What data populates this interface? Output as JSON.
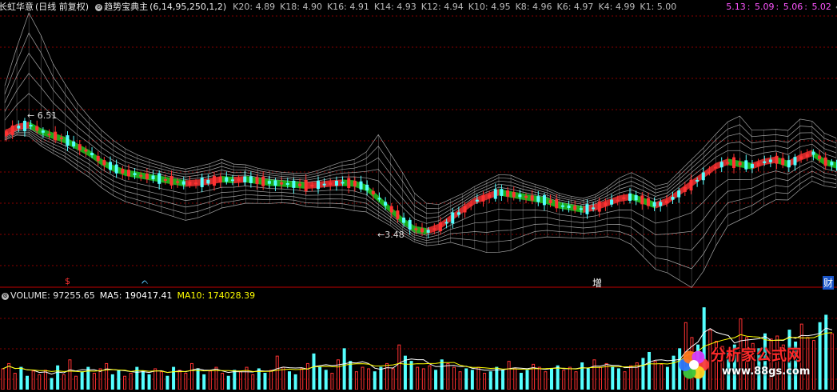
{
  "header": {
    "stock_name": "长虹华意",
    "period": "(日线 前复权)",
    "indicator_name": "趋势宝典主",
    "indicator_params": "(6,14,95,250,1,2)",
    "k_values": [
      {
        "label": "K20: 4.89"
      },
      {
        "label": "K18: 4.90"
      },
      {
        "label": "K16: 4.91"
      },
      {
        "label": "K14: 4.93"
      },
      {
        "label": "K12: 4.94"
      },
      {
        "label": "K10: 4.95"
      },
      {
        "label": "K8: 4.96"
      },
      {
        "label": "K6: 4.97"
      },
      {
        "label": "K4: 4.99"
      },
      {
        "label": "K1: 5.00"
      }
    ],
    "tail_values": [
      "5.13",
      "5.09",
      "5.06",
      "5.02"
    ],
    "sep": ":",
    "diamond": "◇"
  },
  "price_labels": {
    "high": "6.51",
    "low": "3.48"
  },
  "event_markers": {
    "s": "$",
    "up": "ᨈ",
    "zeng": "增",
    "cai": "财"
  },
  "volume_header": {
    "volume": "VOLUME: 97255.65",
    "ma5": "MA5: 190417.41",
    "ma10": "MA10: 174028.39"
  },
  "watermark": {
    "title": "分析家公式网",
    "url": "www.88gs.com"
  },
  "colors": {
    "background": "#000000",
    "grid": "#8a0000",
    "up": "#ff3232",
    "down": "#54ffff",
    "ribbon": "#1fd31f",
    "mesh": "#bfbfbf",
    "k_text": "#bcbcbc",
    "tail_text": "#ff55ff",
    "ma5": "#ffffff",
    "ma10": "#ffff00"
  },
  "chart_data": {
    "type": "candlestick",
    "price_axis": {
      "max_shown_high": 6.51,
      "min_shown_low": 3.48
    },
    "price_series": [
      5.75,
      5.9,
      5.95,
      5.8,
      5.7,
      5.6,
      5.45,
      5.3,
      5.1,
      4.95,
      4.85,
      4.8,
      4.75,
      4.7,
      4.65,
      4.6,
      4.62,
      4.65,
      4.7,
      4.68,
      4.7,
      4.66,
      4.62,
      4.6,
      4.58,
      4.55,
      4.57,
      4.6,
      4.62,
      4.6,
      4.5,
      4.25,
      4.0,
      3.75,
      3.55,
      3.5,
      3.6,
      3.8,
      4.0,
      4.2,
      4.3,
      4.4,
      4.35,
      4.3,
      4.25,
      4.2,
      4.1,
      4.05,
      4.0,
      4.05,
      4.15,
      4.25,
      4.3,
      4.2,
      4.1,
      4.2,
      4.4,
      4.6,
      4.8,
      5.0,
      5.1,
      5.05,
      5.0,
      5.1,
      5.15,
      5.05,
      5.2,
      5.3,
      5.1,
      5.02
    ],
    "volume_series": [
      28,
      35,
      22,
      30,
      18,
      25,
      20,
      26,
      15,
      32,
      20,
      40,
      18,
      24,
      30,
      22,
      28,
      35,
      20,
      26,
      18,
      22,
      30,
      25,
      20,
      28,
      24,
      18,
      30,
      26,
      22,
      35,
      28,
      20,
      25,
      30,
      22,
      18,
      26,
      24,
      30,
      20,
      28,
      22,
      26,
      45,
      30,
      24,
      20,
      28,
      35,
      48,
      30,
      26,
      22,
      40,
      55,
      38,
      24,
      30,
      28,
      24,
      30,
      35,
      28,
      60,
      45,
      38,
      30,
      28,
      32,
      26,
      40,
      35,
      30,
      24,
      28,
      26,
      30,
      22,
      24,
      30,
      26,
      38,
      28,
      22,
      26,
      34,
      30,
      24,
      28,
      32,
      26,
      30,
      24,
      36,
      28,
      40,
      30,
      35,
      30,
      28,
      24,
      32,
      36,
      42,
      50,
      38,
      34,
      30,
      45,
      55,
      90,
      70,
      60,
      110,
      80,
      65,
      58,
      50,
      60,
      95,
      70,
      62,
      55,
      75,
      68,
      72,
      60,
      80,
      64,
      88,
      70,
      66,
      90,
      100,
      75
    ]
  }
}
